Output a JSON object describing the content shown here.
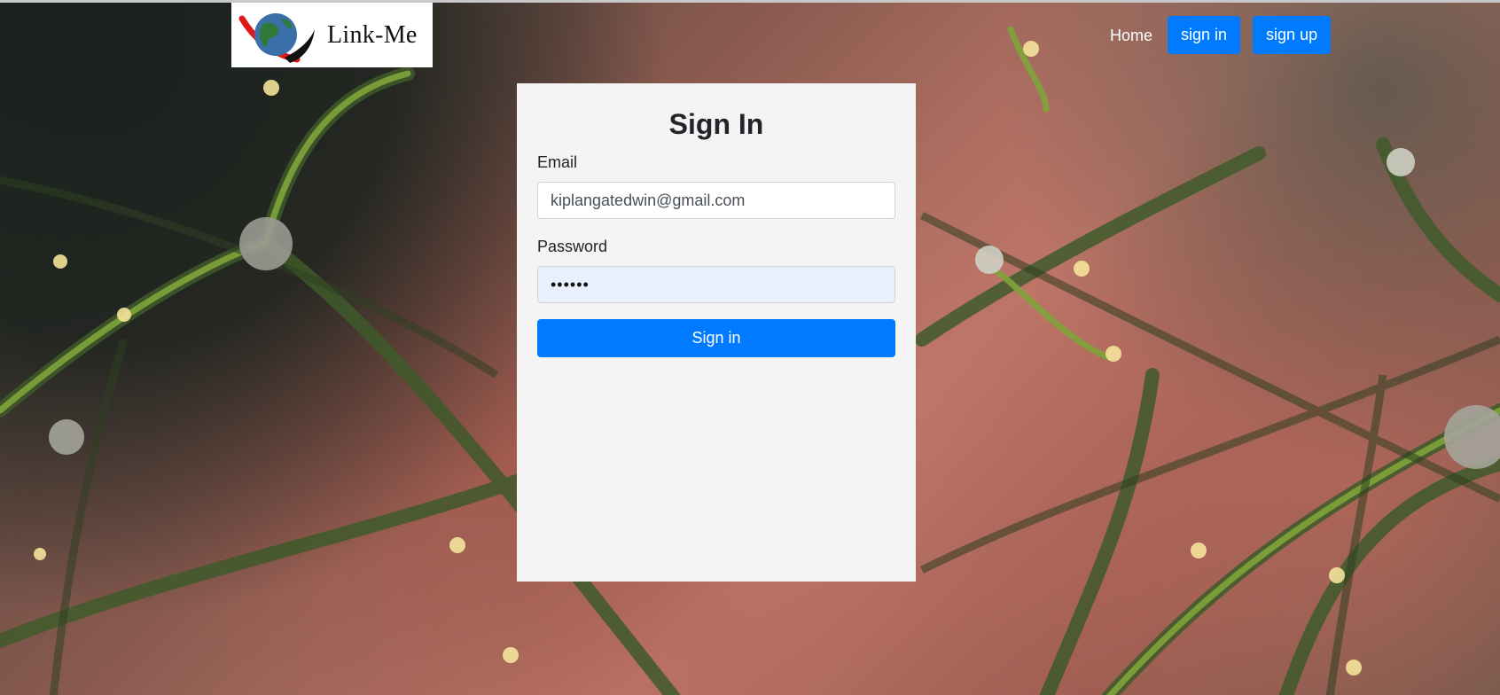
{
  "header": {
    "logo_text": "Link-Me",
    "nav": {
      "home_label": "Home",
      "signin_label": "sign in",
      "signup_label": "sign up"
    }
  },
  "signin_form": {
    "title": "Sign In",
    "email": {
      "label": "Email",
      "value": "kiplangatedwin@gmail.com"
    },
    "password": {
      "label": "Password",
      "value": "••••••"
    },
    "submit_label": "Sign in"
  },
  "colors": {
    "primary": "#007bff",
    "card_bg": "#f4f4f4",
    "autofill_bg": "#e8f0fe"
  },
  "icons": {
    "logo": "globe-swoosh-logo"
  }
}
